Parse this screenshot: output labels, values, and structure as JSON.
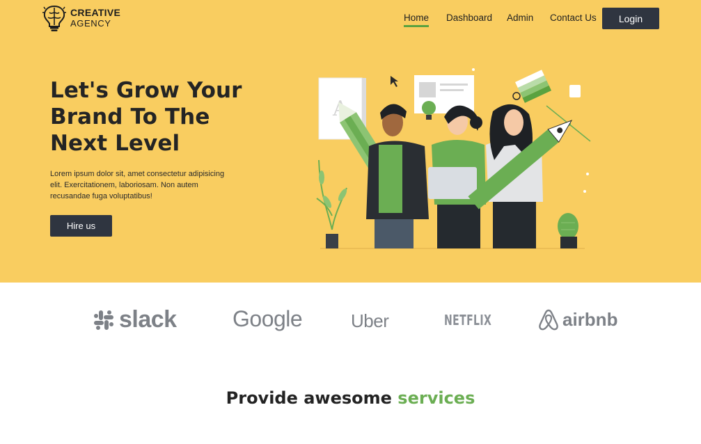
{
  "brand": {
    "line1": "CREATIVE",
    "line2": "AGENCY",
    "logo_icon": "brain-bulb-icon"
  },
  "nav": {
    "items": [
      {
        "label": "Home",
        "active": true
      },
      {
        "label": "Dashboard",
        "active": false
      },
      {
        "label": "Admin",
        "active": false
      },
      {
        "label": "Contact Us",
        "active": false
      }
    ],
    "login_label": "Login"
  },
  "hero": {
    "title": "Let's Grow Your Brand To The Next Level",
    "description": "Lorem ipsum dolor sit, amet consectetur adipisicing elit. Exercitationem, laboriosam. Non autem recusandae fuga voluptatibus!",
    "cta_label": "Hire us",
    "illustration": "creative-team-illustration"
  },
  "partners": [
    {
      "name": "slack",
      "icon": "slack-icon"
    },
    {
      "name": "Google"
    },
    {
      "name": "Uber"
    },
    {
      "name": "NETFLIX"
    },
    {
      "name": "airbnb",
      "icon": "airbnb-icon"
    }
  ],
  "services": {
    "title_prefix": "Provide awesome ",
    "title_accent": "services"
  },
  "colors": {
    "hero_bg": "#f9cd60",
    "dark": "#2f3540",
    "accent_green": "#6bae53",
    "brand_gray": "#7d8187"
  }
}
